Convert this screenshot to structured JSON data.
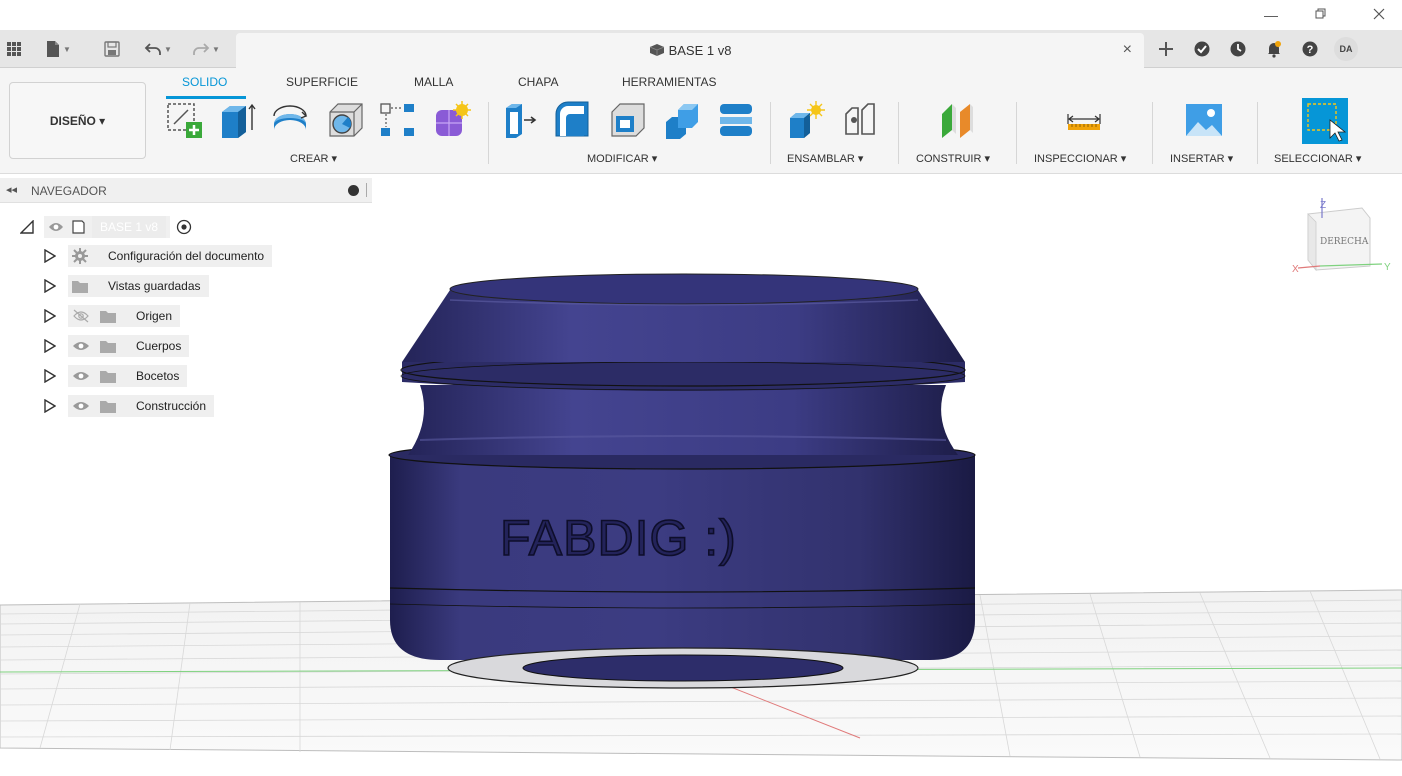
{
  "window": {
    "minimize_icon": "minimize-icon",
    "restore_icon": "restore-icon",
    "close_icon": "close-icon"
  },
  "document_tab": {
    "title": "BASE 1 v8"
  },
  "user": {
    "initials": "DA"
  },
  "workspace": {
    "label": "DISEÑO ▾"
  },
  "ribbon_tabs": [
    {
      "label": "SOLIDO",
      "active": true
    },
    {
      "label": "SUPERFICIE",
      "active": false
    },
    {
      "label": "MALLA",
      "active": false
    },
    {
      "label": "CHAPA",
      "active": false
    },
    {
      "label": "HERRAMIENTAS",
      "active": false
    }
  ],
  "groups": {
    "crear": "CREAR ▾",
    "modificar": "MODIFICAR ▾",
    "ensamblar": "ENSAMBLAR ▾",
    "construir": "CONSTRUIR ▾",
    "inspeccionar": "INSPECCIONAR ▾",
    "insertar": "INSERTAR ▾",
    "seleccionar": "SELECCIONAR ▾"
  },
  "navigator": {
    "title": "NAVEGADOR",
    "root": "BASE 1 v8",
    "items": [
      {
        "label": "Configuración del documento"
      },
      {
        "label": "Vistas guardadas"
      },
      {
        "label": "Origen"
      },
      {
        "label": "Cuerpos"
      },
      {
        "label": "Bocetos"
      },
      {
        "label": "Construcción"
      }
    ]
  },
  "viewcube": {
    "face": "DERECHA",
    "axis_z": "Z",
    "axis_x": "X",
    "axis_y": "Y"
  },
  "model": {
    "engraved_text": "FABDIG :)"
  },
  "colors": {
    "accent": "#0696d7",
    "model_body": "#2f2f6b",
    "model_highlight": "#5a5aa0"
  }
}
